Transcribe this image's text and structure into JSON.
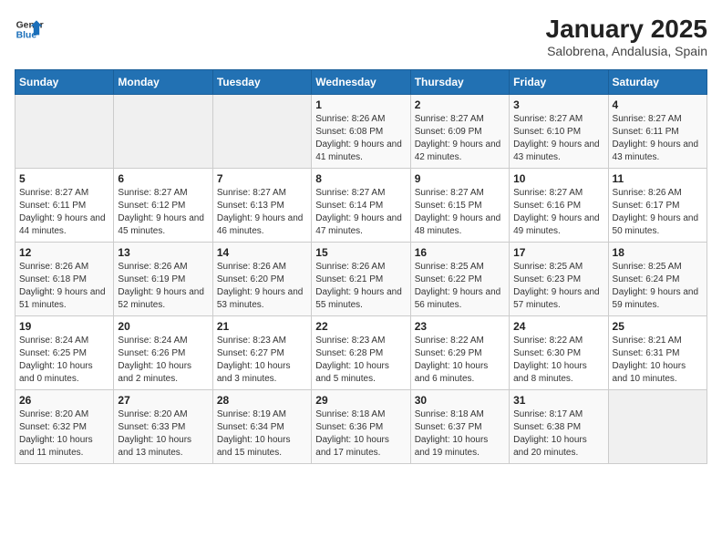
{
  "logo": {
    "line1": "General",
    "line2": "Blue"
  },
  "title": "January 2025",
  "subtitle": "Salobrena, Andalusia, Spain",
  "days_of_week": [
    "Sunday",
    "Monday",
    "Tuesday",
    "Wednesday",
    "Thursday",
    "Friday",
    "Saturday"
  ],
  "weeks": [
    [
      {
        "num": "",
        "info": ""
      },
      {
        "num": "",
        "info": ""
      },
      {
        "num": "",
        "info": ""
      },
      {
        "num": "1",
        "info": "Sunrise: 8:26 AM\nSunset: 6:08 PM\nDaylight: 9 hours and 41 minutes."
      },
      {
        "num": "2",
        "info": "Sunrise: 8:27 AM\nSunset: 6:09 PM\nDaylight: 9 hours and 42 minutes."
      },
      {
        "num": "3",
        "info": "Sunrise: 8:27 AM\nSunset: 6:10 PM\nDaylight: 9 hours and 43 minutes."
      },
      {
        "num": "4",
        "info": "Sunrise: 8:27 AM\nSunset: 6:11 PM\nDaylight: 9 hours and 43 minutes."
      }
    ],
    [
      {
        "num": "5",
        "info": "Sunrise: 8:27 AM\nSunset: 6:11 PM\nDaylight: 9 hours and 44 minutes."
      },
      {
        "num": "6",
        "info": "Sunrise: 8:27 AM\nSunset: 6:12 PM\nDaylight: 9 hours and 45 minutes."
      },
      {
        "num": "7",
        "info": "Sunrise: 8:27 AM\nSunset: 6:13 PM\nDaylight: 9 hours and 46 minutes."
      },
      {
        "num": "8",
        "info": "Sunrise: 8:27 AM\nSunset: 6:14 PM\nDaylight: 9 hours and 47 minutes."
      },
      {
        "num": "9",
        "info": "Sunrise: 8:27 AM\nSunset: 6:15 PM\nDaylight: 9 hours and 48 minutes."
      },
      {
        "num": "10",
        "info": "Sunrise: 8:27 AM\nSunset: 6:16 PM\nDaylight: 9 hours and 49 minutes."
      },
      {
        "num": "11",
        "info": "Sunrise: 8:26 AM\nSunset: 6:17 PM\nDaylight: 9 hours and 50 minutes."
      }
    ],
    [
      {
        "num": "12",
        "info": "Sunrise: 8:26 AM\nSunset: 6:18 PM\nDaylight: 9 hours and 51 minutes."
      },
      {
        "num": "13",
        "info": "Sunrise: 8:26 AM\nSunset: 6:19 PM\nDaylight: 9 hours and 52 minutes."
      },
      {
        "num": "14",
        "info": "Sunrise: 8:26 AM\nSunset: 6:20 PM\nDaylight: 9 hours and 53 minutes."
      },
      {
        "num": "15",
        "info": "Sunrise: 8:26 AM\nSunset: 6:21 PM\nDaylight: 9 hours and 55 minutes."
      },
      {
        "num": "16",
        "info": "Sunrise: 8:25 AM\nSunset: 6:22 PM\nDaylight: 9 hours and 56 minutes."
      },
      {
        "num": "17",
        "info": "Sunrise: 8:25 AM\nSunset: 6:23 PM\nDaylight: 9 hours and 57 minutes."
      },
      {
        "num": "18",
        "info": "Sunrise: 8:25 AM\nSunset: 6:24 PM\nDaylight: 9 hours and 59 minutes."
      }
    ],
    [
      {
        "num": "19",
        "info": "Sunrise: 8:24 AM\nSunset: 6:25 PM\nDaylight: 10 hours and 0 minutes."
      },
      {
        "num": "20",
        "info": "Sunrise: 8:24 AM\nSunset: 6:26 PM\nDaylight: 10 hours and 2 minutes."
      },
      {
        "num": "21",
        "info": "Sunrise: 8:23 AM\nSunset: 6:27 PM\nDaylight: 10 hours and 3 minutes."
      },
      {
        "num": "22",
        "info": "Sunrise: 8:23 AM\nSunset: 6:28 PM\nDaylight: 10 hours and 5 minutes."
      },
      {
        "num": "23",
        "info": "Sunrise: 8:22 AM\nSunset: 6:29 PM\nDaylight: 10 hours and 6 minutes."
      },
      {
        "num": "24",
        "info": "Sunrise: 8:22 AM\nSunset: 6:30 PM\nDaylight: 10 hours and 8 minutes."
      },
      {
        "num": "25",
        "info": "Sunrise: 8:21 AM\nSunset: 6:31 PM\nDaylight: 10 hours and 10 minutes."
      }
    ],
    [
      {
        "num": "26",
        "info": "Sunrise: 8:20 AM\nSunset: 6:32 PM\nDaylight: 10 hours and 11 minutes."
      },
      {
        "num": "27",
        "info": "Sunrise: 8:20 AM\nSunset: 6:33 PM\nDaylight: 10 hours and 13 minutes."
      },
      {
        "num": "28",
        "info": "Sunrise: 8:19 AM\nSunset: 6:34 PM\nDaylight: 10 hours and 15 minutes."
      },
      {
        "num": "29",
        "info": "Sunrise: 8:18 AM\nSunset: 6:36 PM\nDaylight: 10 hours and 17 minutes."
      },
      {
        "num": "30",
        "info": "Sunrise: 8:18 AM\nSunset: 6:37 PM\nDaylight: 10 hours and 19 minutes."
      },
      {
        "num": "31",
        "info": "Sunrise: 8:17 AM\nSunset: 6:38 PM\nDaylight: 10 hours and 20 minutes."
      },
      {
        "num": "",
        "info": ""
      }
    ]
  ]
}
